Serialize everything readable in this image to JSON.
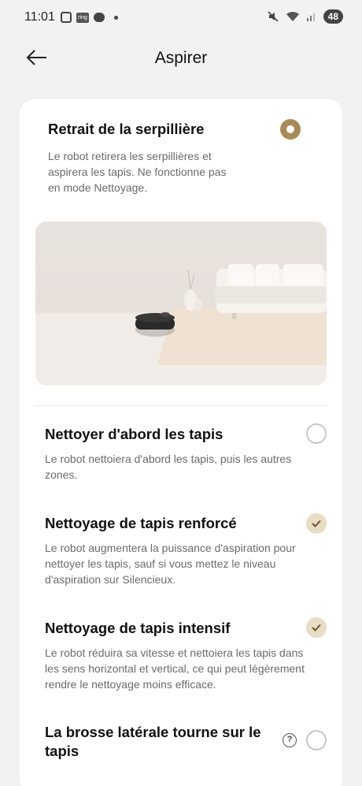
{
  "status_bar": {
    "time": "11:01",
    "ring_label": "ring",
    "battery": "48"
  },
  "header": {
    "title": "Aspirer"
  },
  "options": [
    {
      "title": "Retrait de la serpillière",
      "description": "Le robot retirera les serpillières et aspirera les tapis. Ne fonctionne pas en mode Nettoyage.",
      "control": "radio",
      "selected": true
    },
    {
      "title": "Nettoyer d'abord les tapis",
      "description": "Le robot nettoiera d'abord les tapis, puis les autres zones.",
      "control": "radio",
      "selected": false
    },
    {
      "title": "Nettoyage de tapis renforcé",
      "description": "Le robot augmentera la puissance d'aspiration pour nettoyer les tapis, sauf si vous mettez le niveau d'aspiration sur Silencieux.",
      "control": "check",
      "selected": true
    },
    {
      "title": "Nettoyage de tapis intensif",
      "description": "Le robot réduira sa vitesse et nettoiera les tapis dans les sens horizontal et vertical, ce qui peut légèrement rendre le nettoyage moins efficace.",
      "control": "check",
      "selected": true
    },
    {
      "title": "La brosse latérale tourne sur le tapis",
      "control": "radio",
      "selected": false
    }
  ],
  "colors": {
    "accent": "#a88a5a",
    "check_bg": "#e8dcc3",
    "background": "#f2f2f2"
  }
}
